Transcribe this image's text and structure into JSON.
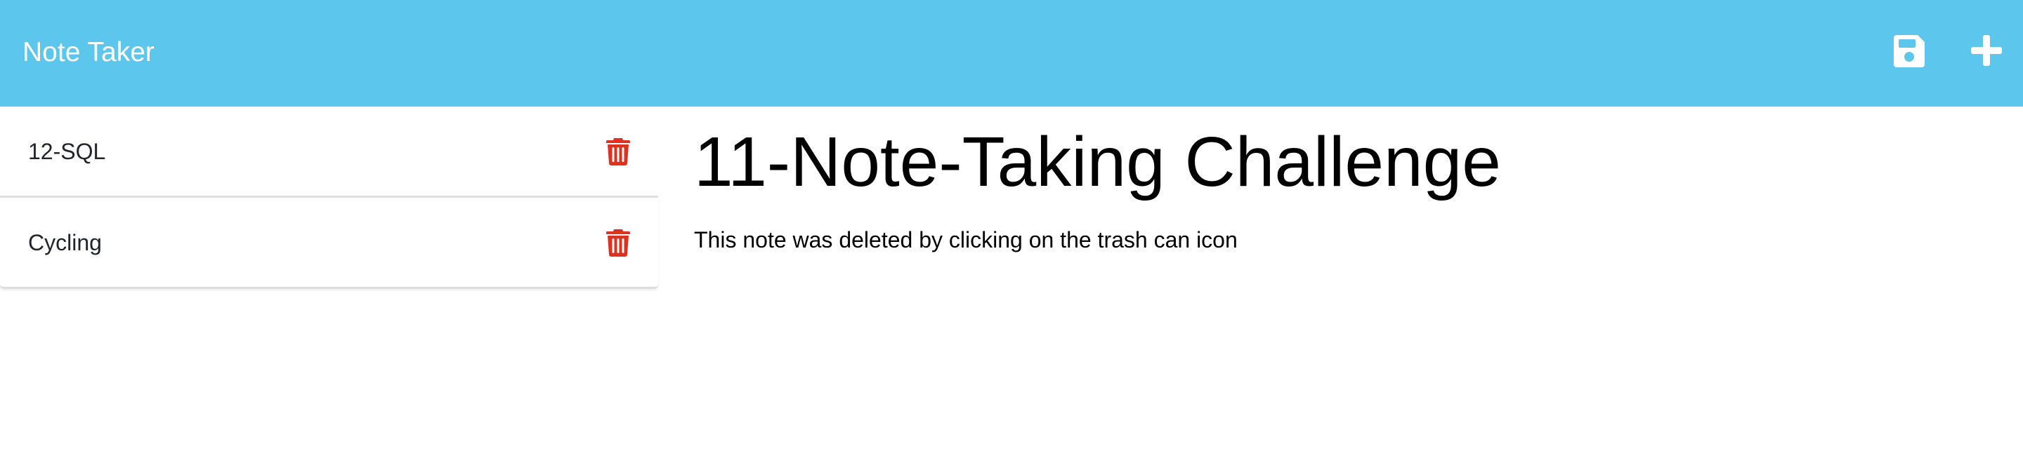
{
  "app": {
    "brand": "Note Taker"
  },
  "toolbar": {
    "save_icon": "save-icon",
    "new_note_icon": "plus-icon"
  },
  "notes": [
    {
      "title": "12-SQL",
      "delete_icon": "trash-icon"
    },
    {
      "title": "Cycling",
      "delete_icon": "trash-icon"
    }
  ],
  "editor": {
    "title_value": "11-Note-Taking Challenge",
    "text_value": "This note was deleted by clicking on the trash can icon"
  },
  "colors": {
    "navbar_bg": "#5cc6ed",
    "trash_red": "#e0301e",
    "text": "#212529"
  }
}
